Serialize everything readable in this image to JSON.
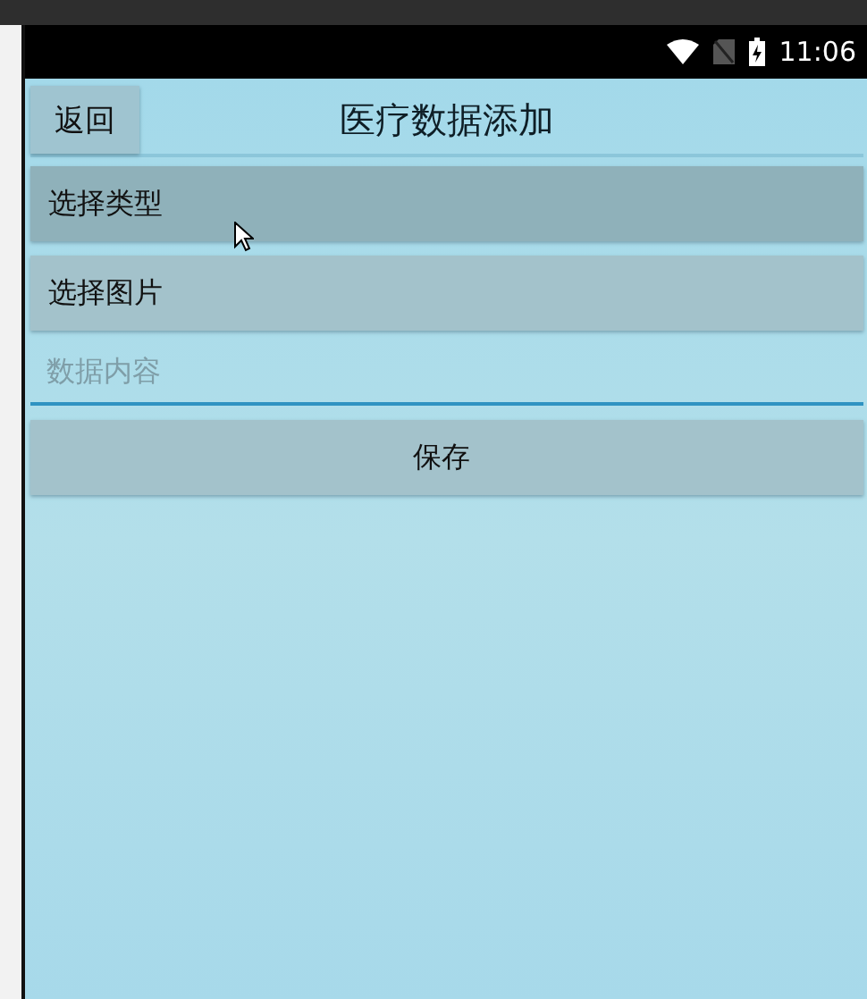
{
  "status_bar": {
    "time": "11:06"
  },
  "header": {
    "back_button": "返回",
    "title": "医疗数据添加"
  },
  "form": {
    "buttons": [
      {
        "label": "选择类型",
        "highlighted": true
      },
      {
        "label": "选择图片",
        "highlighted": false
      }
    ],
    "content_field": {
      "placeholder": "数据内容"
    },
    "save_button": "保存"
  }
}
